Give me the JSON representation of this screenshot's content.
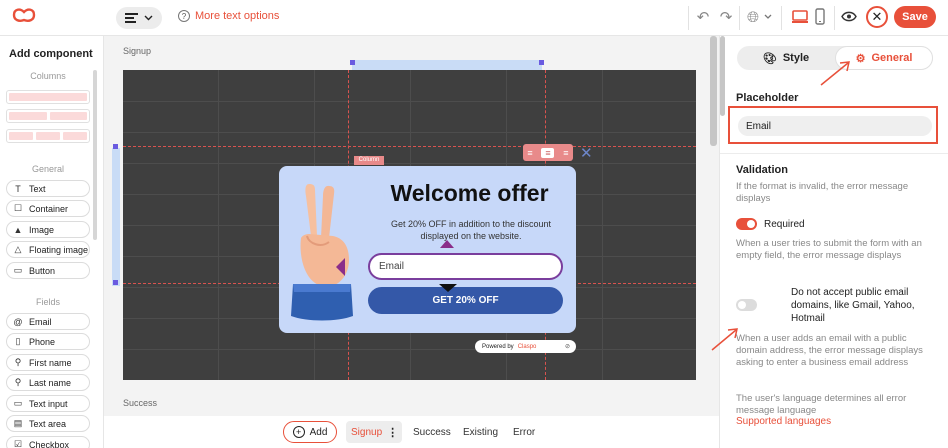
{
  "toolbar": {
    "align_icon": "align-left-icon",
    "more_text_options": "More text options",
    "save_label": "Save"
  },
  "left_panel": {
    "title": "Add component",
    "columns_label": "Columns",
    "general_label": "General",
    "general_items": [
      {
        "label": "Text",
        "icon": "text-icon"
      },
      {
        "label": "Container",
        "icon": "container-icon"
      },
      {
        "label": "Image",
        "icon": "image-icon"
      },
      {
        "label": "Floating image",
        "icon": "floating-image-icon"
      },
      {
        "label": "Button",
        "icon": "button-icon"
      }
    ],
    "fields_label": "Fields",
    "field_items": [
      {
        "label": "Email",
        "icon": "at-icon"
      },
      {
        "label": "Phone",
        "icon": "phone-icon"
      },
      {
        "label": "First name",
        "icon": "person-icon"
      },
      {
        "label": "Last name",
        "icon": "person-icon"
      },
      {
        "label": "Text input",
        "icon": "text-input-icon"
      },
      {
        "label": "Text area",
        "icon": "text-area-icon"
      },
      {
        "label": "Checkbox",
        "icon": "checkbox-icon"
      }
    ]
  },
  "canvas": {
    "signup_label": "Signup",
    "success_label": "Success",
    "column_tag": "Column",
    "popup": {
      "title": "Welcome offer",
      "subtitle": "Get 20% OFF in addition to the discount displayed on the website.",
      "email_placeholder": "Email",
      "button_label": "GET 20% OFF",
      "powered_by": "Powered by",
      "brand": "Claspo"
    }
  },
  "bottom_bar": {
    "add_label": "Add",
    "steps": [
      "Signup",
      "Success",
      "Existing",
      "Error"
    ],
    "active_step": "Signup"
  },
  "right_panel": {
    "tab_style": "Style",
    "tab_general": "General",
    "placeholder_heading": "Placeholder",
    "placeholder_value": "Email",
    "validation_heading": "Validation",
    "validation_desc": "If the format is invalid, the error message displays",
    "required_label": "Required",
    "required_on": true,
    "required_desc": "When a user tries to submit the form with an empty field, the error message displays",
    "public_email_label": "Do not accept public email domains, like Gmail, Yahoo, Hotmail",
    "public_email_on": false,
    "public_email_desc": "When a user adds an email with a public domain address, the error message displays asking to enter a business email address",
    "language_note": "The user's language determines all error message language",
    "supported_languages_link": "Supported languages"
  },
  "colors": {
    "accent": "#e8503a",
    "popup_bg": "#c7d8f9",
    "cta": "#3458a8"
  }
}
